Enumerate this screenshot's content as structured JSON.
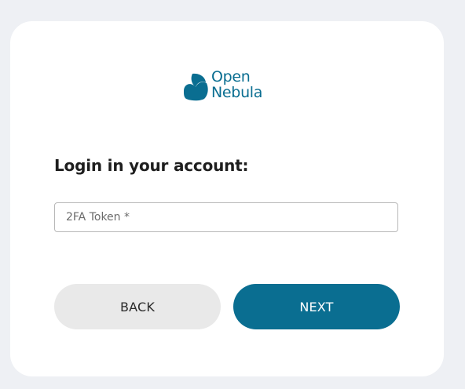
{
  "logo": {
    "line1": "Open",
    "line2": "Nebula",
    "icon": "opennebula-logo-icon"
  },
  "login": {
    "heading": "Login in your account:",
    "token_field": {
      "placeholder": "2FA Token *",
      "value": ""
    },
    "back_label": "BACK",
    "next_label": "NEXT"
  },
  "colors": {
    "brand": "#0a6e91",
    "back_button_bg": "#e9e9e9",
    "page_bg": "#eef0f4",
    "card_bg": "#ffffff"
  }
}
